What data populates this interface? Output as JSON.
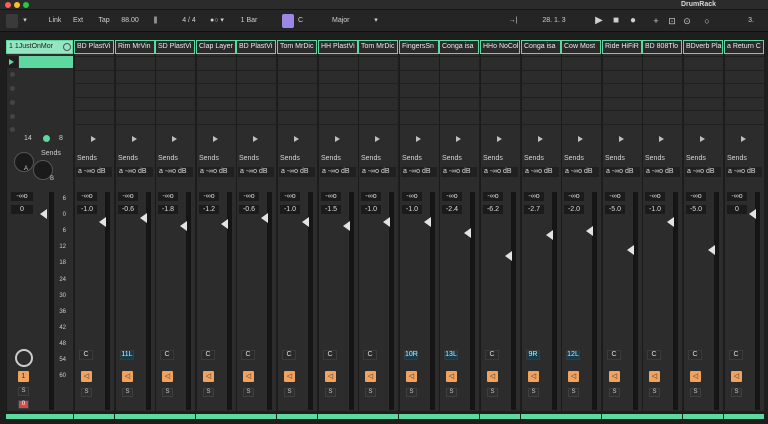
{
  "window": {
    "title": "DrumRack"
  },
  "transport": {
    "link": "Link",
    "ext": "Ext",
    "tap": "Tap",
    "tempo": "88.00",
    "meter": "4 / 4",
    "quant": "1 Bar",
    "key": "C",
    "scale": "Major",
    "position": "28. 1. 3",
    "right_position": "3."
  },
  "master": {
    "title": "1 1JustOnMor",
    "count_left": "14",
    "count_right": "8",
    "sends_label": "Sends",
    "knob_a": "A",
    "knob_b": "B",
    "vol_top": "-∞o",
    "vol_val": "0",
    "scale": [
      "6",
      "0",
      "6",
      "12",
      "18",
      "24",
      "30",
      "36",
      "42",
      "48",
      "54",
      "60"
    ],
    "number": "1",
    "solo": "S",
    "rec": "0"
  },
  "tracks": [
    {
      "name": "BD PlastVi",
      "vol": "-1.0",
      "pan": "C",
      "pan_hl": false,
      "fader": 0.88
    },
    {
      "name": "Rim MrVin",
      "vol": "-0.6",
      "pan": "11L",
      "pan_hl": true,
      "fader": 0.9
    },
    {
      "name": "SD PlastVi",
      "vol": "-1.8",
      "pan": "C",
      "pan_hl": false,
      "fader": 0.86
    },
    {
      "name": "Clap Layer",
      "vol": "-1.2",
      "pan": "C",
      "pan_hl": false,
      "fader": 0.87
    },
    {
      "name": "BD PlastVi",
      "vol": "-0.6",
      "pan": "C",
      "pan_hl": false,
      "fader": 0.9
    },
    {
      "name": "Tom MrDic",
      "vol": "-1.0",
      "pan": "C",
      "pan_hl": false,
      "fader": 0.88
    },
    {
      "name": "HH PlastVi",
      "vol": "-1.5",
      "pan": "C",
      "pan_hl": false,
      "fader": 0.86
    },
    {
      "name": "Tom MrDic",
      "vol": "-1.0",
      "pan": "C",
      "pan_hl": false,
      "fader": 0.88
    },
    {
      "name": "FingersSn",
      "vol": "-1.0",
      "pan": "10R",
      "pan_hl": true,
      "fader": 0.88
    },
    {
      "name": "Conga isa",
      "vol": "-2.4",
      "pan": "13L",
      "pan_hl": true,
      "fader": 0.83
    },
    {
      "name": "HHo NoCol",
      "vol": "-6.2",
      "pan": "C",
      "pan_hl": false,
      "fader": 0.72
    },
    {
      "name": "Conga isa",
      "vol": "-2.7",
      "pan": "9R",
      "pan_hl": true,
      "fader": 0.82
    },
    {
      "name": "Cow Most",
      "vol": "-2.0",
      "pan": "12L",
      "pan_hl": true,
      "fader": 0.84
    },
    {
      "name": "Ride HiFiR",
      "vol": "-5.0",
      "pan": "C",
      "pan_hl": false,
      "fader": 0.75
    },
    {
      "name": "BD 808Tlo",
      "vol": "-1.0",
      "pan": "C",
      "pan_hl": false,
      "fader": 0.88
    },
    {
      "name": "BDverb Pla",
      "vol": "-5.0",
      "pan": "C",
      "pan_hl": false,
      "fader": 0.75
    },
    {
      "name": "a Return C",
      "vol": "0",
      "pan": "C",
      "pan_hl": false,
      "fader": 0.92
    }
  ],
  "common": {
    "sends": "Sends",
    "send_a": "a",
    "send_val": "-∞o dB",
    "vol_top": "-∞o",
    "solo": "S"
  }
}
